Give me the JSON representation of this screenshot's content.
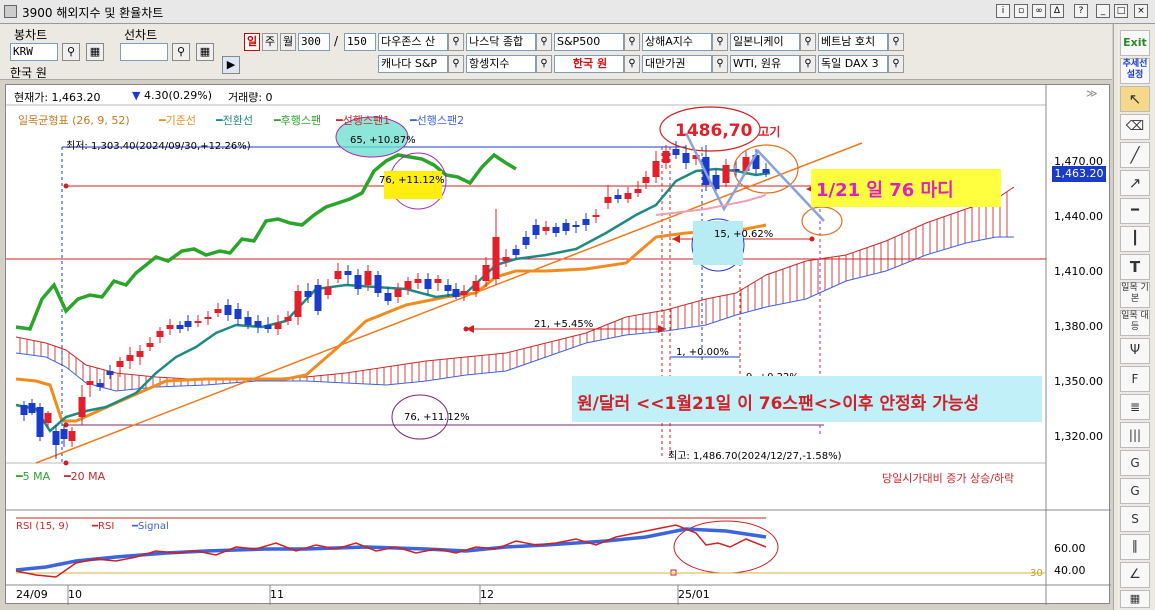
{
  "window": {
    "title": "3900 해외지수 및 환율차트"
  },
  "left_panel": {
    "bong_label": "봉차트",
    "bong_code": "KRW",
    "bong_name": "한국 원",
    "sun_label": "선차트",
    "sun_code": ""
  },
  "period": {
    "day": "일",
    "week": "주",
    "month": "월",
    "count": "300",
    "sep": "/",
    "max": "150"
  },
  "indices": [
    {
      "label": "다우존스 산",
      "selected": false
    },
    {
      "label": "나스닥 종합",
      "selected": false
    },
    {
      "label": "S&P500",
      "selected": false
    },
    {
      "label": "상해A지수",
      "selected": false
    },
    {
      "label": "일본니케이",
      "selected": false
    },
    {
      "label": "베트남 호치",
      "selected": false
    },
    {
      "label": "캐나다 S&P",
      "selected": false
    },
    {
      "label": "항셍지수",
      "selected": false
    },
    {
      "label": "한국 원",
      "selected": true
    },
    {
      "label": "대만가권",
      "selected": false
    },
    {
      "label": "WTI, 원유",
      "selected": false
    },
    {
      "label": "독일 DAX 3",
      "selected": false
    }
  ],
  "info_bar": {
    "current_label": "현재가: 1,463.20",
    "change": "4.30(0.29%)",
    "volume_label": "거래량: 0"
  },
  "legend": {
    "ichimoku": "일목균형표 (26, 9, 52)",
    "base": "기준선",
    "conv": "전환선",
    "lagging": "후행스팬",
    "lead1": "선행스팬1",
    "lead2": "선행스팬2"
  },
  "y_axis": {
    "ticks": [
      "1,470.00",
      "1,440.00",
      "1,410.00",
      "1,380.00",
      "1,350.00",
      "1,320.00"
    ],
    "current_price": "1,463.20"
  },
  "annotations": {
    "low_text": "최저: 1,303.40(2024/09/30,+12.26%)",
    "high_text": "최고: 1,486.70(2024/12/27,-1.58%)",
    "high_callout": "1486,70",
    "high_callout_small": "고기",
    "n65": "65, +10.87%",
    "n76a": "76, +11.12%",
    "n76b": "76, +11.12%",
    "n21": "21, +5.45%",
    "n15": "15, +0.62%",
    "n1": "1, +0.00%",
    "n9": "9, +0.22%",
    "node_text": "1/21 일 76 마디",
    "stable_text": "원/달러 <<1월21일 이 76스팬<>이후 안정화 가능성"
  },
  "ma_legend": {
    "ma5": "5 MA",
    "ma20": "20 MA",
    "right": "당일시가대비 증가 상승/하락"
  },
  "rsi": {
    "label": "RSI (15, 9)",
    "rsi_name": "RSI",
    "signal_name": "Signal",
    "y_ticks": [
      "60.00",
      "40.00"
    ],
    "marker": "30"
  },
  "x_axis": [
    "24/09",
    "10",
    "11",
    "12",
    "25/01"
  ],
  "right_toolbar": {
    "exit": "Exit",
    "trend": "추세선 설정",
    "ichi_basic": "일목 기본",
    "ichi_dae": "일목 대등"
  },
  "colors": {
    "up": "#e0202a",
    "down": "#1a3cc8",
    "base": "#f08c1e",
    "conv": "#1f8a82",
    "lagging": "#2aa52a",
    "lead1": "#c82828",
    "lead2": "#3c64dc"
  }
}
